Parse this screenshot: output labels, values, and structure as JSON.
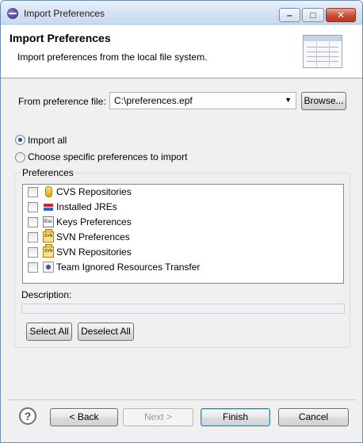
{
  "window": {
    "title": "Import Preferences",
    "minimize_glyph": "‒",
    "maximize_glyph": "□",
    "close_glyph": "✕"
  },
  "banner": {
    "title": "Import Preferences",
    "description": "Import preferences from the local file system."
  },
  "file": {
    "label": "From preference file:",
    "value": "C:\\preferences.epf",
    "dropdown_glyph": "▼",
    "browse_label": "Browse..."
  },
  "options": {
    "import_all": {
      "label": "Import all",
      "selected": true
    },
    "choose_specific": {
      "label": "Choose specific preferences to import",
      "selected": false
    }
  },
  "preferences": {
    "group_label": "Preferences",
    "items": [
      {
        "label": "CVS Repositories",
        "icon": "cvs-icon",
        "checked": false
      },
      {
        "label": "Installed JREs",
        "icon": "jre-icon",
        "checked": false
      },
      {
        "label": "Keys Preferences",
        "icon": "keys-icon",
        "checked": false,
        "icon_text": "Esc"
      },
      {
        "label": "SVN Preferences",
        "icon": "svn-icon",
        "checked": false,
        "icon_text": "SVN"
      },
      {
        "label": "SVN Repositories",
        "icon": "svn-icon",
        "checked": false,
        "icon_text": "SVN"
      },
      {
        "label": "Team Ignored Resources Transfer",
        "icon": "team-icon",
        "checked": false
      }
    ],
    "description_label": "Description:",
    "description_value": "",
    "select_all_label": "Select All",
    "deselect_all_label": "Deselect All"
  },
  "footer": {
    "help_glyph": "?",
    "back_label": "< Back",
    "next_label": "Next >",
    "finish_label": "Finish",
    "cancel_label": "Cancel",
    "next_enabled": false
  },
  "colors": {
    "dialog_bg": "#f0f0f0",
    "titlebar": "#d3e2f3",
    "close_button": "#c94a35",
    "default_button_border": "#3c7fb1"
  }
}
